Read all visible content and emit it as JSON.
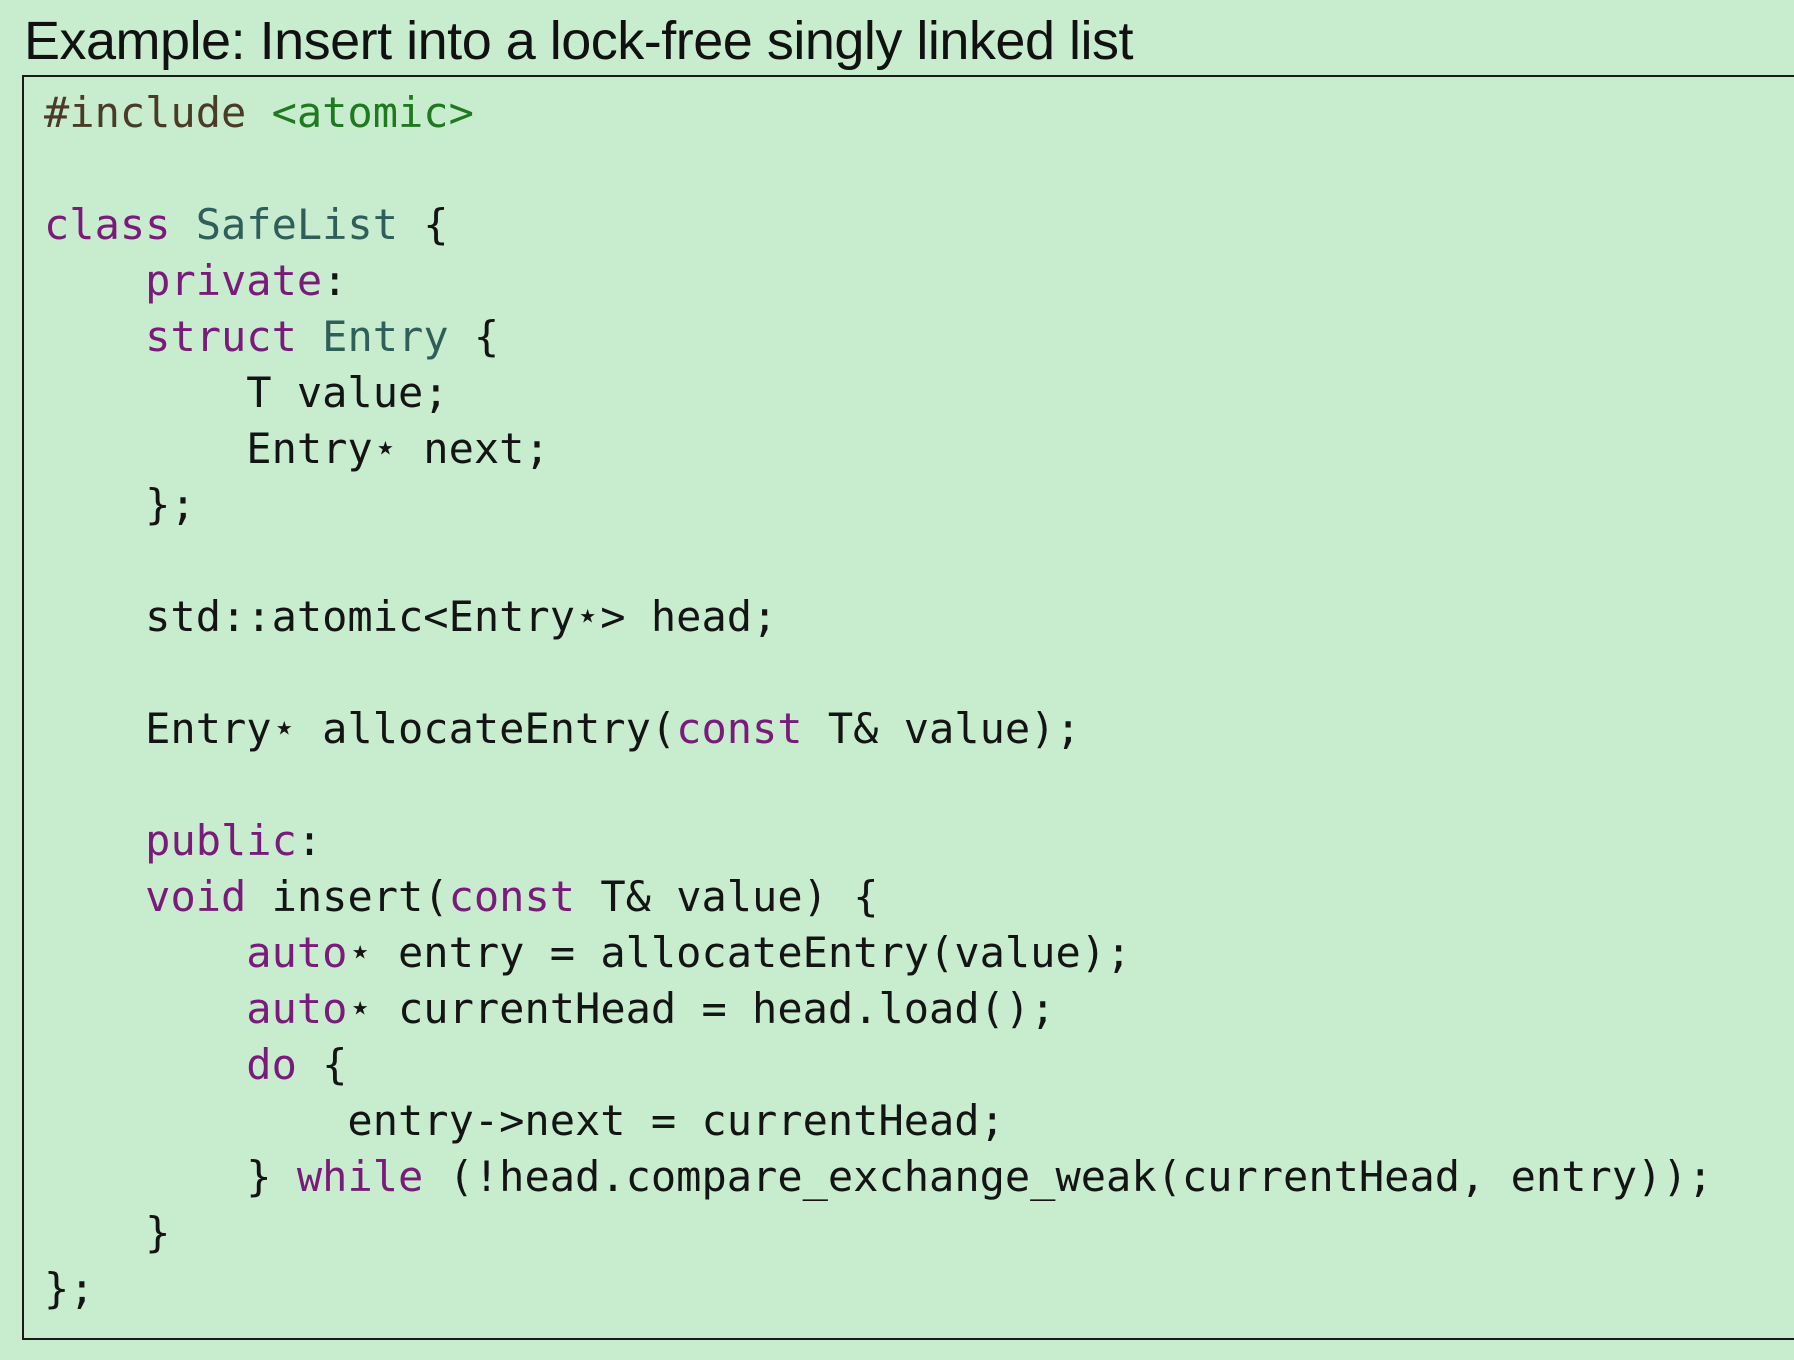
{
  "title": "Example: Insert into a lock-free singly linked list",
  "code_lines": [
    [
      [
        "pp",
        "#include "
      ],
      [
        "str",
        "<atomic>"
      ]
    ],
    [],
    [
      [
        "kw",
        "class "
      ],
      [
        "type",
        "SafeList"
      ],
      [
        "txt",
        " {"
      ]
    ],
    [
      [
        "txt",
        "    "
      ],
      [
        "kw",
        "private"
      ],
      [
        "txt",
        ":"
      ]
    ],
    [
      [
        "txt",
        "    "
      ],
      [
        "kw",
        "struct "
      ],
      [
        "type",
        "Entry"
      ],
      [
        "txt",
        " {"
      ]
    ],
    [
      [
        "txt",
        "        T value;"
      ]
    ],
    [
      [
        "txt",
        "        Entry⋆ next;"
      ]
    ],
    [
      [
        "txt",
        "    };"
      ]
    ],
    [],
    [
      [
        "txt",
        "    std::atomic<Entry⋆> head;"
      ]
    ],
    [],
    [
      [
        "txt",
        "    Entry⋆ allocateEntry("
      ],
      [
        "kw",
        "const"
      ],
      [
        "txt",
        " T& value);"
      ]
    ],
    [],
    [
      [
        "txt",
        "    "
      ],
      [
        "kw",
        "public"
      ],
      [
        "txt",
        ":"
      ]
    ],
    [
      [
        "txt",
        "    "
      ],
      [
        "kw",
        "void"
      ],
      [
        "txt",
        " insert("
      ],
      [
        "kw",
        "const"
      ],
      [
        "txt",
        " T& value) {"
      ]
    ],
    [
      [
        "txt",
        "        "
      ],
      [
        "kw",
        "auto"
      ],
      [
        "txt",
        "⋆ entry = allocateEntry(value);"
      ]
    ],
    [
      [
        "txt",
        "        "
      ],
      [
        "kw",
        "auto"
      ],
      [
        "txt",
        "⋆ currentHead = head.load();"
      ]
    ],
    [
      [
        "txt",
        "        "
      ],
      [
        "kw",
        "do"
      ],
      [
        "txt",
        " {"
      ]
    ],
    [
      [
        "txt",
        "            entry->next = currentHead;"
      ]
    ],
    [
      [
        "txt",
        "        } "
      ],
      [
        "kw",
        "while"
      ],
      [
        "txt",
        " (!head.compare_exchange_weak(currentHead, entry));"
      ]
    ],
    [
      [
        "txt",
        "    }"
      ]
    ],
    [
      [
        "txt",
        "};"
      ]
    ]
  ],
  "colors": {
    "background": "#c8ecce",
    "keyword": "#7a1a7a",
    "type_name": "#2f5f5a",
    "preprocessor": "#4a3a26",
    "string": "#1f7a1f",
    "text": "#141414"
  }
}
